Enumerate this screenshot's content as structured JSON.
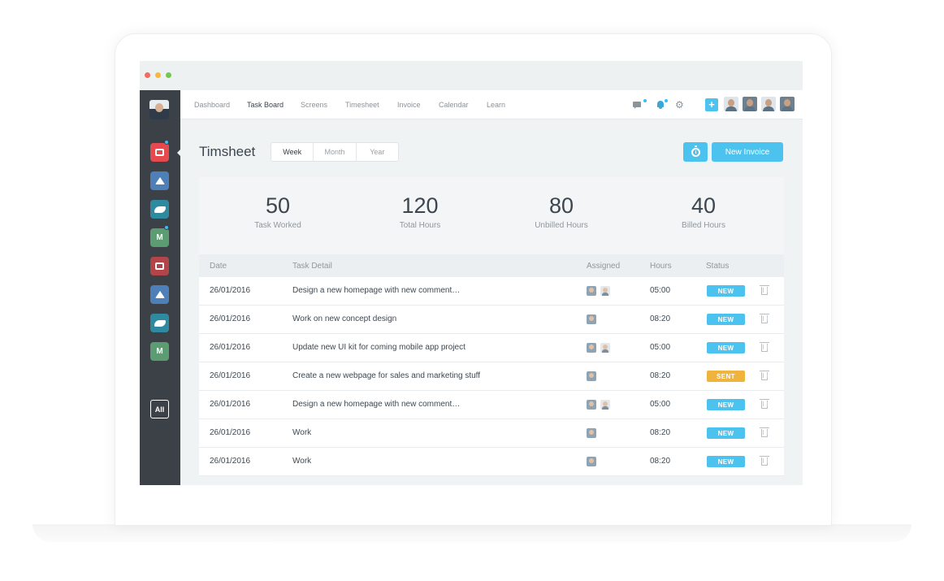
{
  "window": {
    "controls": [
      "close",
      "minimize",
      "maximize"
    ]
  },
  "sidebar": {
    "apps": [
      {
        "name": "speaker-deck-app",
        "color": "#e64a4f",
        "active": true,
        "notify": true
      },
      {
        "name": "dropbox-app",
        "color": "#4d7fb8"
      },
      {
        "name": "pelican-app",
        "color": "#2f8aa0"
      },
      {
        "name": "m-app",
        "label": "M",
        "color": "#5b9c73",
        "notify": true
      },
      {
        "name": "speaker-deck-app",
        "color": "#b3454a"
      },
      {
        "name": "dropbox-app",
        "color": "#4d7fb8"
      },
      {
        "name": "pelican-app",
        "color": "#2f8aa0"
      },
      {
        "name": "m-app",
        "label": "M",
        "color": "#5b9c73"
      }
    ],
    "all_label": "All"
  },
  "nav": {
    "items": [
      "Dashboard",
      "Task Board",
      "Screens",
      "Timesheet",
      "Invoice",
      "Calendar",
      "Learn"
    ],
    "active": "Task Board",
    "icons": [
      "chat-icon",
      "bell-icon",
      "gear-icon"
    ],
    "plus_label": "+"
  },
  "page": {
    "title": "Timsheet",
    "segments": [
      "Week",
      "Month",
      "Year"
    ],
    "active_segment": "Week",
    "timer_icon": "stopwatch-icon",
    "new_invoice_label": "New Invoice"
  },
  "stats": [
    {
      "value": "50",
      "label": "Task Worked"
    },
    {
      "value": "120",
      "label": "Total Hours"
    },
    {
      "value": "80",
      "label": "Unbilled Hours"
    },
    {
      "value": "40",
      "label": "Billed Hours"
    }
  ],
  "table": {
    "headers": {
      "date": "Date",
      "task": "Task Detail",
      "assigned": "Assigned",
      "hours": "Hours",
      "status": "Status"
    },
    "rows": [
      {
        "date": "26/01/2016",
        "task": "Design a new homepage with new comment…",
        "assignees": 2,
        "hours": "05:00",
        "status": "NEW"
      },
      {
        "date": "26/01/2016",
        "task": "Work on new concept design",
        "assignees": 1,
        "hours": "08:20",
        "status": "NEW"
      },
      {
        "date": "26/01/2016",
        "task": "Update new UI kit for coming mobile app project",
        "assignees": 2,
        "hours": "05:00",
        "status": "NEW"
      },
      {
        "date": "26/01/2016",
        "task": "Create a new webpage for sales and marketing stuff",
        "assignees": 1,
        "hours": "08:20",
        "status": "SENT"
      },
      {
        "date": "26/01/2016",
        "task": "Design a new homepage with new comment…",
        "assignees": 2,
        "hours": "05:00",
        "status": "NEW"
      },
      {
        "date": "26/01/2016",
        "task": "Work",
        "assignees": 1,
        "hours": "08:20",
        "status": "NEW"
      },
      {
        "date": "26/01/2016",
        "task": "Work",
        "assignees": 1,
        "hours": "08:20",
        "status": "NEW"
      }
    ]
  },
  "colors": {
    "accent": "#4cc3ef",
    "sent": "#f0b43c",
    "sidebar": "#3c4148"
  }
}
